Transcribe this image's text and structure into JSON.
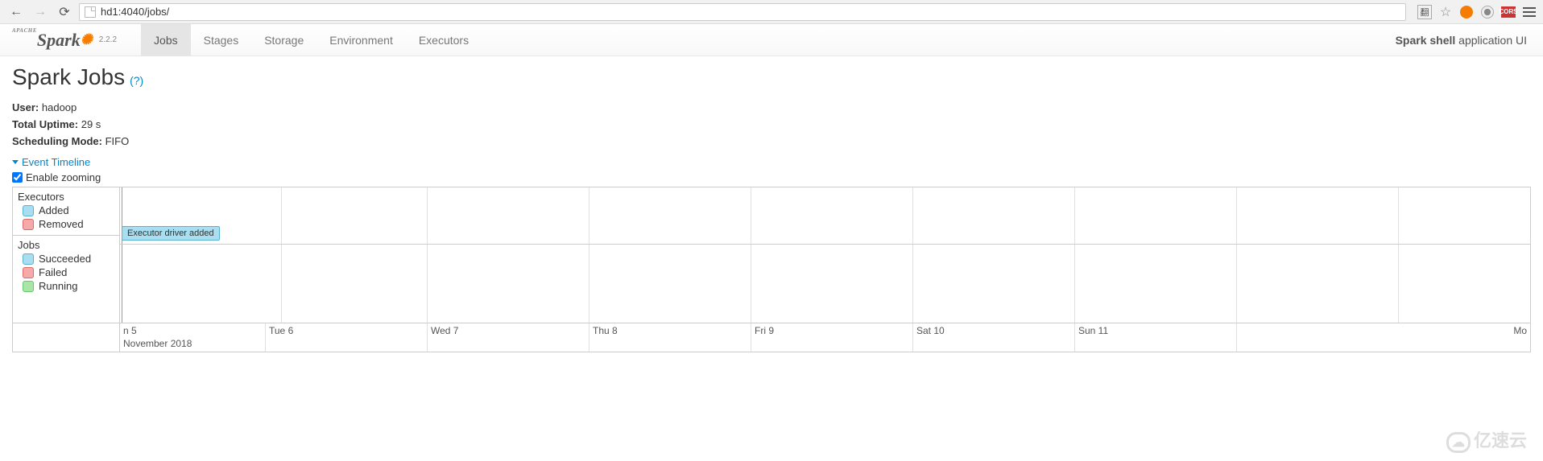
{
  "browser": {
    "url": "hd1:4040/jobs/",
    "translate_label": "翻",
    "cors_label": "CORS"
  },
  "navbar": {
    "brand_apache": "APACHE",
    "brand_name": "Spark",
    "version": "2.2.2",
    "tabs": [
      {
        "label": "Jobs",
        "active": true
      },
      {
        "label": "Stages",
        "active": false
      },
      {
        "label": "Storage",
        "active": false
      },
      {
        "label": "Environment",
        "active": false
      },
      {
        "label": "Executors",
        "active": false
      }
    ],
    "app_name": "Spark shell",
    "app_suffix": "application UI"
  },
  "page": {
    "title": "Spark Jobs",
    "help": "(?)",
    "user_label": "User:",
    "user_value": "hadoop",
    "uptime_label": "Total Uptime:",
    "uptime_value": "29 s",
    "sched_label": "Scheduling Mode:",
    "sched_value": "FIFO",
    "event_timeline": "Event Timeline",
    "enable_zoom": "Enable zooming"
  },
  "timeline": {
    "legend": {
      "executors_header": "Executors",
      "added": "Added",
      "removed": "Removed",
      "jobs_header": "Jobs",
      "succeeded": "Succeeded",
      "failed": "Failed",
      "running": "Running"
    },
    "event_label": "Executor driver added",
    "axis": {
      "ticks": [
        "n 5",
        "Tue 6",
        "Wed 7",
        "Thu 8",
        "Fri 9",
        "Sat 10",
        "Sun 11"
      ],
      "last": "Mo",
      "month": "November 2018"
    }
  },
  "watermark": "亿速云"
}
